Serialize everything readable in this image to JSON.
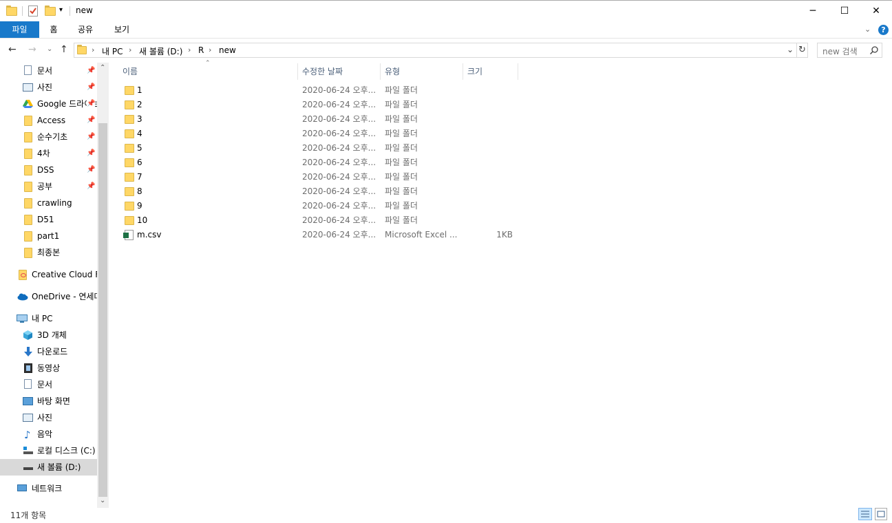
{
  "window": {
    "title": "new",
    "controls": {
      "minimize": "─",
      "maximize": "☐",
      "close": "✕"
    }
  },
  "ribbon": {
    "tabs": [
      {
        "label": "파일",
        "active": true
      },
      {
        "label": "홈"
      },
      {
        "label": "공유"
      },
      {
        "label": "보기"
      }
    ],
    "file_tab_color": "#1979ca",
    "help_icon": "?"
  },
  "address": {
    "crumbs": [
      "내 PC",
      "새 볼륨 (D:)",
      "R",
      "new"
    ],
    "search_placeholder": "new 검색"
  },
  "sidebar": {
    "items": [
      {
        "label": "문서",
        "icon": "documents-icon",
        "pinned": true
      },
      {
        "label": "사진",
        "icon": "pictures-icon",
        "pinned": true
      },
      {
        "label": "Google 드라이브",
        "icon": "google-drive-icon",
        "pinned": true
      },
      {
        "label": "Access",
        "icon": "folder-icon",
        "pinned": true
      },
      {
        "label": "순수기초",
        "icon": "folder-icon",
        "pinned": true
      },
      {
        "label": "4차",
        "icon": "folder-icon",
        "pinned": true
      },
      {
        "label": "DSS",
        "icon": "folder-icon",
        "pinned": true
      },
      {
        "label": "공부",
        "icon": "folder-icon",
        "pinned": true
      },
      {
        "label": "crawling",
        "icon": "folder-icon"
      },
      {
        "label": "D51",
        "icon": "folder-icon"
      },
      {
        "label": "part1",
        "icon": "folder-icon"
      },
      {
        "label": "최종본",
        "icon": "folder-icon"
      },
      {
        "label": "Creative Cloud Files",
        "icon": "creative-cloud-icon"
      },
      {
        "label": "OneDrive - 연세대학교",
        "icon": "onedrive-icon"
      },
      {
        "label": "내 PC",
        "icon": "this-pc-icon"
      },
      {
        "label": "3D 개체",
        "icon": "3d-objects-icon"
      },
      {
        "label": "다운로드",
        "icon": "downloads-icon"
      },
      {
        "label": "동영상",
        "icon": "videos-icon"
      },
      {
        "label": "문서",
        "icon": "documents-icon"
      },
      {
        "label": "바탕 화면",
        "icon": "desktop-icon"
      },
      {
        "label": "사진",
        "icon": "pictures-icon"
      },
      {
        "label": "음악",
        "icon": "music-icon"
      },
      {
        "label": "로컬 디스크 (C:)",
        "icon": "local-disk-icon"
      },
      {
        "label": "새 볼륨 (D:)",
        "icon": "drive-icon",
        "selected": true
      },
      {
        "label": "네트워크",
        "icon": "network-icon"
      }
    ]
  },
  "columns": {
    "name": "이름",
    "date": "수정한 날짜",
    "type": "유형",
    "size": "크기"
  },
  "files": [
    {
      "name": "1",
      "date": "2020-06-24 오후...",
      "type": "파일 폴더",
      "size": "",
      "kind": "folder"
    },
    {
      "name": "2",
      "date": "2020-06-24 오후...",
      "type": "파일 폴더",
      "size": "",
      "kind": "folder"
    },
    {
      "name": "3",
      "date": "2020-06-24 오후...",
      "type": "파일 폴더",
      "size": "",
      "kind": "folder"
    },
    {
      "name": "4",
      "date": "2020-06-24 오후...",
      "type": "파일 폴더",
      "size": "",
      "kind": "folder"
    },
    {
      "name": "5",
      "date": "2020-06-24 오후...",
      "type": "파일 폴더",
      "size": "",
      "kind": "folder"
    },
    {
      "name": "6",
      "date": "2020-06-24 오후...",
      "type": "파일 폴더",
      "size": "",
      "kind": "folder"
    },
    {
      "name": "7",
      "date": "2020-06-24 오후...",
      "type": "파일 폴더",
      "size": "",
      "kind": "folder"
    },
    {
      "name": "8",
      "date": "2020-06-24 오후...",
      "type": "파일 폴더",
      "size": "",
      "kind": "folder"
    },
    {
      "name": "9",
      "date": "2020-06-24 오후...",
      "type": "파일 폴더",
      "size": "",
      "kind": "folder"
    },
    {
      "name": "10",
      "date": "2020-06-24 오후...",
      "type": "파일 폴더",
      "size": "",
      "kind": "folder"
    },
    {
      "name": "m.csv",
      "date": "2020-06-24 오후...",
      "type": "Microsoft Excel ...",
      "size": "1KB",
      "kind": "csv"
    }
  ],
  "status": {
    "item_count": "11개 항목"
  }
}
